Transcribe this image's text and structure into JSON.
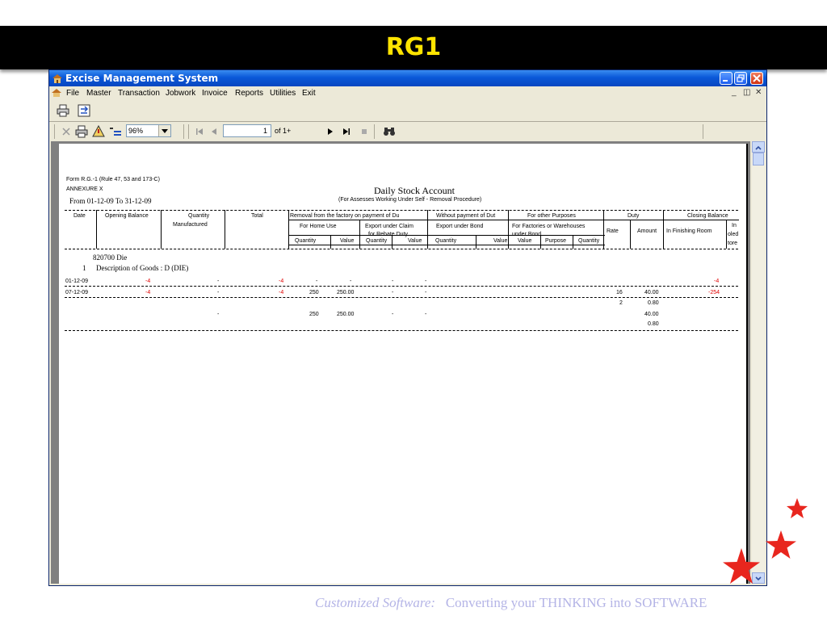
{
  "slide": {
    "title": "RG1",
    "footer_italic": "Customized Software:",
    "footer_rest": "Converting your THINKING into SOFTWARE",
    "accent_color": "#ffe400",
    "star_color": "#e8261e"
  },
  "window": {
    "title": "Excise Management System",
    "controls": [
      "minimize-icon",
      "restore-icon",
      "close-icon"
    ]
  },
  "menu": {
    "items": [
      "File",
      "Master",
      "Transaction",
      "Jobwork",
      "Invoice",
      "Reports",
      "Utilities",
      "Exit"
    ]
  },
  "viewer": {
    "zoom": "96%",
    "page_current": "1",
    "page_total": "of 1+"
  },
  "report": {
    "form_line": "Form R.G.-1 (Rule 47, 53 and 173-C)",
    "annex": "ANNEXURE X",
    "period": "From 01-12-09  To 31-12-09",
    "title": "Daily Stock Account",
    "subtitle": "(For Assesses Working Under Self - Removal Procedure)",
    "headers": {
      "date": "Date",
      "opening": "Opening Balance",
      "qty_manufactured_1": "Quantity",
      "qty_manufactured_2": "Manufactured",
      "total": "Total",
      "removal": "Removal from the factory on payment of Du",
      "without_payment": "Without payment of Dut",
      "other_purposes": "For  other Purposes",
      "duty": "Duty",
      "closing": "Closing Balance",
      "home_use": "For Home Use",
      "export_claim_1": "Export under Claim",
      "export_claim_2": "for Rebate Duty",
      "export_bond": "Export under Bond",
      "factories_1": "For Factories or Warehouses",
      "factories_2": "under Bond",
      "rate": "Rate",
      "amount": "Amount",
      "finishing": "In Finishing Room",
      "in_store_1": "In",
      "in_store_2": "oled",
      "in_store_3": "tore",
      "quantity": "Quantity",
      "value": "Value",
      "purpose": "Purpose"
    },
    "item_code": "820700  Die",
    "item_no": "1",
    "item_desc": "Description of Goods :  D (DIE)",
    "rows": [
      {
        "date": "01-12-09",
        "opening": "-4",
        "qty": "-",
        "total": "-4",
        "home_qty": "-",
        "home_val": "-",
        "exp_qty": "-",
        "exp_val": "-",
        "bond_qty": "-",
        "rate": "",
        "amount": "",
        "finishing": "-4"
      },
      {
        "date": "07-12-09",
        "opening": "-4",
        "qty": "-",
        "total": "-4",
        "home_qty": "250",
        "home_val": "250.00",
        "exp_qty": "-",
        "exp_val": "-",
        "bond_qty": "-",
        "rate": "16",
        "amount": "40.00",
        "finishing": "-254"
      }
    ],
    "extra": {
      "rate": "2",
      "amount": "0.80"
    },
    "totals": {
      "qty": "-",
      "home_qty": "250",
      "home_val": "250.00",
      "exp_val": "-",
      "bond_qty": "-",
      "amount1": "40.00",
      "amount2": "0.80"
    }
  }
}
